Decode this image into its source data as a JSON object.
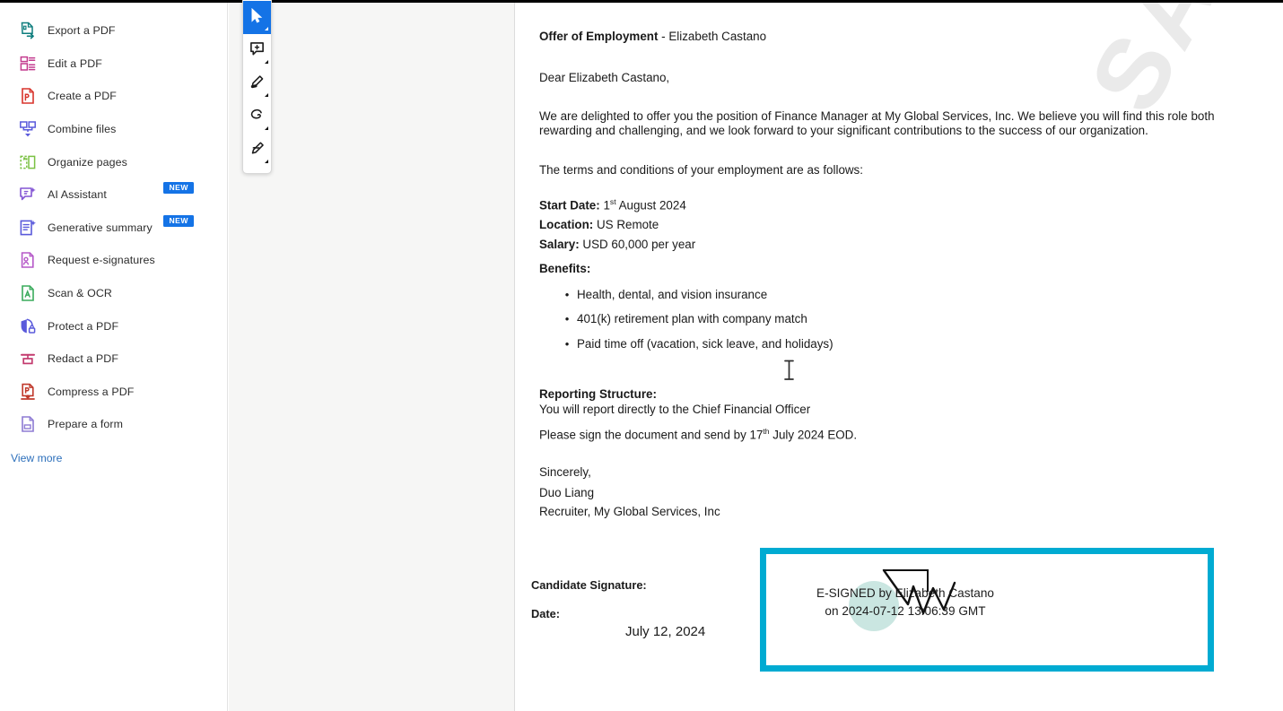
{
  "sidebar": {
    "tools": [
      {
        "label": "Export a PDF",
        "icon": "export-pdf-icon",
        "color": "#0d7d7d",
        "badge": null
      },
      {
        "label": "Edit a PDF",
        "icon": "edit-pdf-icon",
        "color": "#c33a8e",
        "badge": null
      },
      {
        "label": "Create a PDF",
        "icon": "create-pdf-icon",
        "color": "#d8342c",
        "badge": null
      },
      {
        "label": "Combine files",
        "icon": "combine-files-icon",
        "color": "#5a5adb",
        "badge": null
      },
      {
        "label": "Organize pages",
        "icon": "organize-pages-icon",
        "color": "#7bc143",
        "badge": null
      },
      {
        "label": "AI Assistant",
        "icon": "ai-assistant-icon",
        "color": "#8355d4",
        "badge": "NEW"
      },
      {
        "label": "Generative summary",
        "icon": "generative-summary-icon",
        "color": "#5a5adb",
        "badge": "NEW"
      },
      {
        "label": "Request e-signatures",
        "icon": "request-esignatures-icon",
        "color": "#b558c8",
        "badge": null
      },
      {
        "label": "Scan & OCR",
        "icon": "scan-ocr-icon",
        "color": "#3aab5c",
        "badge": null
      },
      {
        "label": "Protect a PDF",
        "icon": "protect-pdf-icon",
        "color": "#5a5adb",
        "badge": null
      },
      {
        "label": "Redact a PDF",
        "icon": "redact-pdf-icon",
        "color": "#c33a6e",
        "badge": null
      },
      {
        "label": "Compress a PDF",
        "icon": "compress-pdf-icon",
        "color": "#c0392b",
        "badge": null
      },
      {
        "label": "Prepare a form",
        "icon": "prepare-form-icon",
        "color": "#8e7bd4",
        "badge": null
      }
    ],
    "view_more_label": "View more"
  },
  "annotation_toolbar": {
    "tools": [
      {
        "icon": "select-cursor-icon",
        "name": "select-tool",
        "active": true
      },
      {
        "icon": "add-comment-icon",
        "name": "comment-tool",
        "active": false
      },
      {
        "icon": "highlighter-icon",
        "name": "highlight-tool",
        "active": false
      },
      {
        "icon": "lasso-erase-icon",
        "name": "erase-tool",
        "active": false
      },
      {
        "icon": "pen-draw-icon",
        "name": "draw-tool",
        "active": false
      }
    ]
  },
  "document": {
    "watermark": "SANDBOX",
    "title_bold": "Offer of Employment",
    "title_rest": "- Elizabeth Castano",
    "salutation": "Dear Elizabeth Castano,",
    "intro": "We are delighted to offer you the position of Finance Manager at My Global Services, Inc. We believe you will find this role both rewarding and challenging, and we look forward to your significant contributions to the success of our organization.",
    "terms_intro": "The terms and conditions of your employment are as follows:",
    "terms": [
      {
        "label": "Start Date:",
        "value_pre": "1",
        "value_sup": "st",
        "value_post": " August 2024"
      },
      {
        "label": "Location:",
        "value_pre": "US Remote",
        "value_sup": "",
        "value_post": ""
      },
      {
        "label": "Salary:",
        "value_pre": "USD 60,000 per year",
        "value_sup": "",
        "value_post": ""
      }
    ],
    "benefits_label": "Benefits:",
    "benefits": [
      "Health, dental, and vision insurance",
      "401(k) retirement plan with company match",
      "Paid time off (vacation, sick leave, and holidays)"
    ],
    "reporting_label": "Reporting Structure:",
    "reporting_value": "You will report directly to the Chief Financial Officer",
    "deadline_pre": "Please sign the document and send by 17",
    "deadline_sup": "th",
    "deadline_post": " July 2024 EOD.",
    "closing": "Sincerely,",
    "sender_name": "Duo Liang",
    "sender_title": "Recruiter, My Global Services, Inc",
    "signature_block": {
      "candidate_signature_label": "Candidate Signature:",
      "date_label": "Date:",
      "date_value": "July 12, 2024",
      "esign_line1": "E-SIGNED by Elizabeth Castano",
      "esign_line2": "on 2024-07-12 13:06:39 GMT"
    }
  },
  "colors": {
    "highlight_border": "#00abd2",
    "badge_blue": "#1473e6",
    "link_blue": "#2c6fbb",
    "page_bg": "#f6f6f5"
  }
}
